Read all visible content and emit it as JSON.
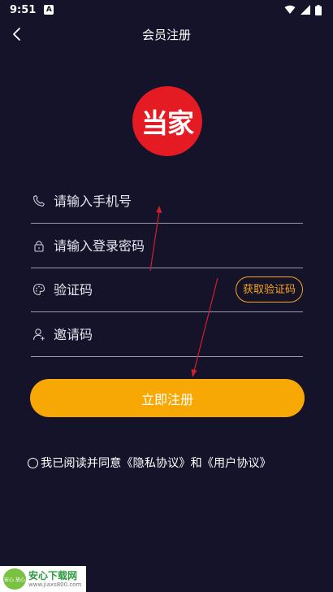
{
  "status_bar": {
    "time": "9:51",
    "notification_icon": "A"
  },
  "header": {
    "title": "会员注册"
  },
  "logo": {
    "text": "当家"
  },
  "form": {
    "phone_placeholder": "请输入手机号",
    "password_placeholder": "请输入登录密码",
    "code_placeholder": "验证码",
    "get_code_label": "获取验证码",
    "invite_placeholder": "邀请码"
  },
  "register_button": {
    "label": "立即注册"
  },
  "agreement": {
    "prefix": "我已阅读并同意",
    "privacy_link": "《隐私协议》",
    "conjunction": "和",
    "user_link": "《用户协议》"
  },
  "watermark": {
    "title": "安心下载网",
    "url": "www.jiaxs800.com",
    "badge": "安心 放心"
  },
  "colors": {
    "background": "#14132a",
    "accent": "#f7a805",
    "logo": "#e41b23",
    "annotation_arrow": "#d0202a"
  }
}
